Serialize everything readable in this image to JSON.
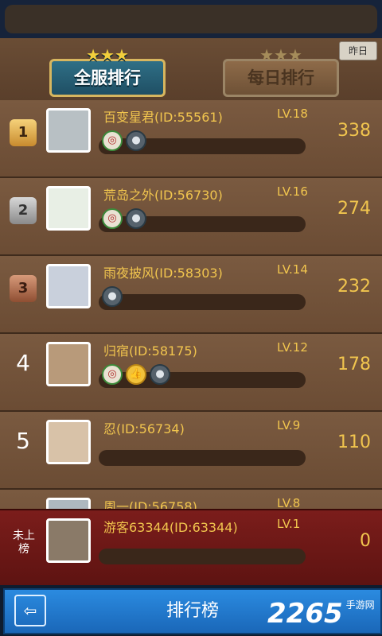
{
  "header": {
    "yesterday_label": "昨日",
    "tab_all": "全服排行",
    "tab_daily": "每日排行"
  },
  "rows": [
    {
      "rank_type": "gold",
      "rank": "1",
      "name": "百变星君(ID:55561)",
      "level": "LV.18",
      "score": "338",
      "icons": [
        "red",
        "mouse"
      ]
    },
    {
      "rank_type": "silver",
      "rank": "2",
      "name": "荒岛之外(ID:56730)",
      "level": "LV.16",
      "score": "274",
      "icons": [
        "red",
        "mouse"
      ]
    },
    {
      "rank_type": "bronze",
      "rank": "3",
      "name": "雨夜披风(ID:58303)",
      "level": "LV.14",
      "score": "232",
      "icons": [
        "mouse"
      ]
    },
    {
      "rank_type": "number",
      "rank": "4",
      "name": "归宿(ID:58175)",
      "level": "LV.12",
      "score": "178",
      "icons": [
        "red",
        "thumb",
        "mouse"
      ]
    },
    {
      "rank_type": "number",
      "rank": "5",
      "name": "忍(ID:56734)",
      "level": "LV.9",
      "score": "110",
      "icons": []
    },
    {
      "rank_type": "number",
      "rank": "",
      "name": "周一(ID:56758)",
      "level": "LV.8",
      "score": "",
      "icons": []
    }
  ],
  "self": {
    "rank_label": "未上\n榜",
    "name": "游客63344(ID:63344)",
    "level": "LV.1",
    "score": "0"
  },
  "bottom": {
    "title": "排行榜",
    "watermark": "2265",
    "watermark_sub": "手游网"
  }
}
